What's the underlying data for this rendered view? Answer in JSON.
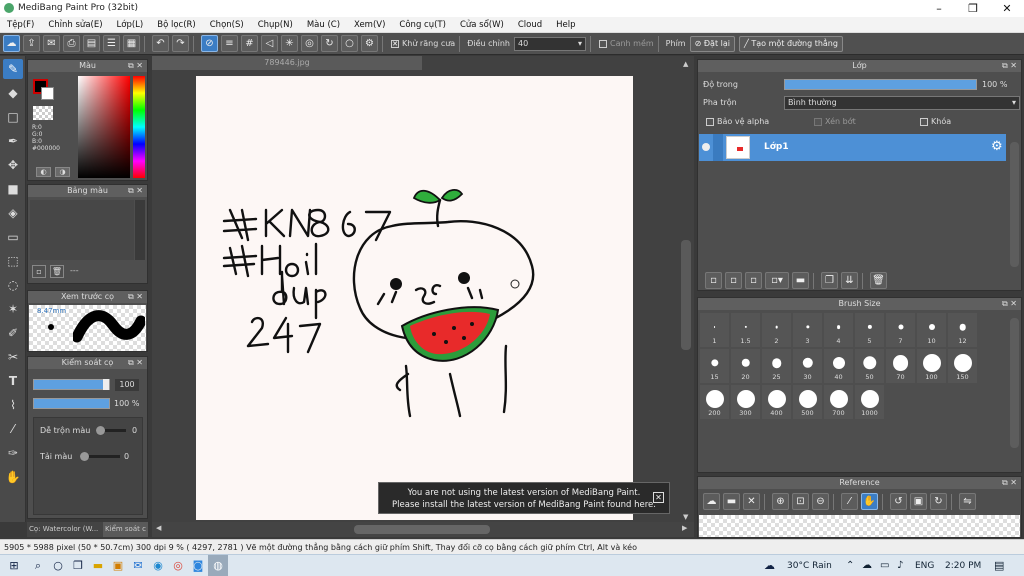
{
  "app": {
    "title": "MediBang Paint Pro (32bit)"
  },
  "menu": [
    "Tệp(F)",
    "Chỉnh sửa(E)",
    "Lớp(L)",
    "Bộ lọc(R)",
    "Chọn(S)",
    "Chụp(N)",
    "Màu (C)",
    "Xem(V)",
    "Công cụ(T)",
    "Cửa sổ(W)",
    "Cloud",
    "Help"
  ],
  "toolbar": {
    "antialias_label": "Khử răng cưa",
    "adjust_label": "Điều chỉnh",
    "adjust_value": "40",
    "snap_label": "Canh mềm",
    "key_label": "Phím",
    "reset_label": "Đặt lại",
    "line_label": "Tạo một đường thẳng"
  },
  "color_panel": {
    "title": "Màu",
    "r": "R:0",
    "g": "G:0",
    "b": "B:0",
    "hex": "#000000"
  },
  "palette_panel": {
    "title": "Bảng màu",
    "count": "---"
  },
  "preview_panel": {
    "title": "Xem trước cọ",
    "size": "8.47mm"
  },
  "brush_control": {
    "title": "Kiểm soát cọ",
    "size_value": "100",
    "opacity_value": "100 %",
    "opacity_fill": 1.0,
    "mix_label": "Dễ trộn màu",
    "mix_value": "0",
    "paint_label": "Tải màu",
    "paint_value": "0"
  },
  "bottom_tabs": [
    "Cọ: Watercolor (W...",
    "Kiểm soát c"
  ],
  "document": {
    "tab": "789446.jpg"
  },
  "layer_panel": {
    "title": "Lớp",
    "opacity_label": "Độ trong",
    "opacity_value": "100 %",
    "opacity_fill": 1.0,
    "blend_label": "Pha trộn",
    "blend_value": "Bình thường",
    "protect_alpha": "Bảo vệ alpha",
    "clipping": "Xén bớt",
    "lock": "Khóa",
    "layers": [
      {
        "name": "Lớp1"
      }
    ]
  },
  "brush_size": {
    "title": "Brush Size",
    "sizes": [
      "1",
      "1.5",
      "2",
      "3",
      "4",
      "5",
      "7",
      "10",
      "12",
      "15",
      "20",
      "25",
      "30",
      "40",
      "50",
      "70",
      "100",
      "150",
      "200",
      "300",
      "400",
      "500",
      "700",
      "1000"
    ]
  },
  "reference": {
    "title": "Reference"
  },
  "notice": {
    "line1": "You are not using the latest version of MediBang Paint.",
    "line2": "Please install the latest version of MediBang Paint found here."
  },
  "status": {
    "text": "5905 * 5988 pixel  (50 * 50.7cm)  300 dpi  9 %  ( 4297, 2781 )  Vẽ một đường thẳng bằng cách giữ phím Shift, Thay đổi cỡ cọ bằng cách giữ phím Ctrl, Alt và kéo"
  },
  "taskbar": {
    "weather": "30°C  Rain",
    "lang": "ENG",
    "time": "2:20 PM"
  },
  "colors": {
    "accent": "#3b7dc4",
    "layer_selected": "#4d90d6"
  }
}
